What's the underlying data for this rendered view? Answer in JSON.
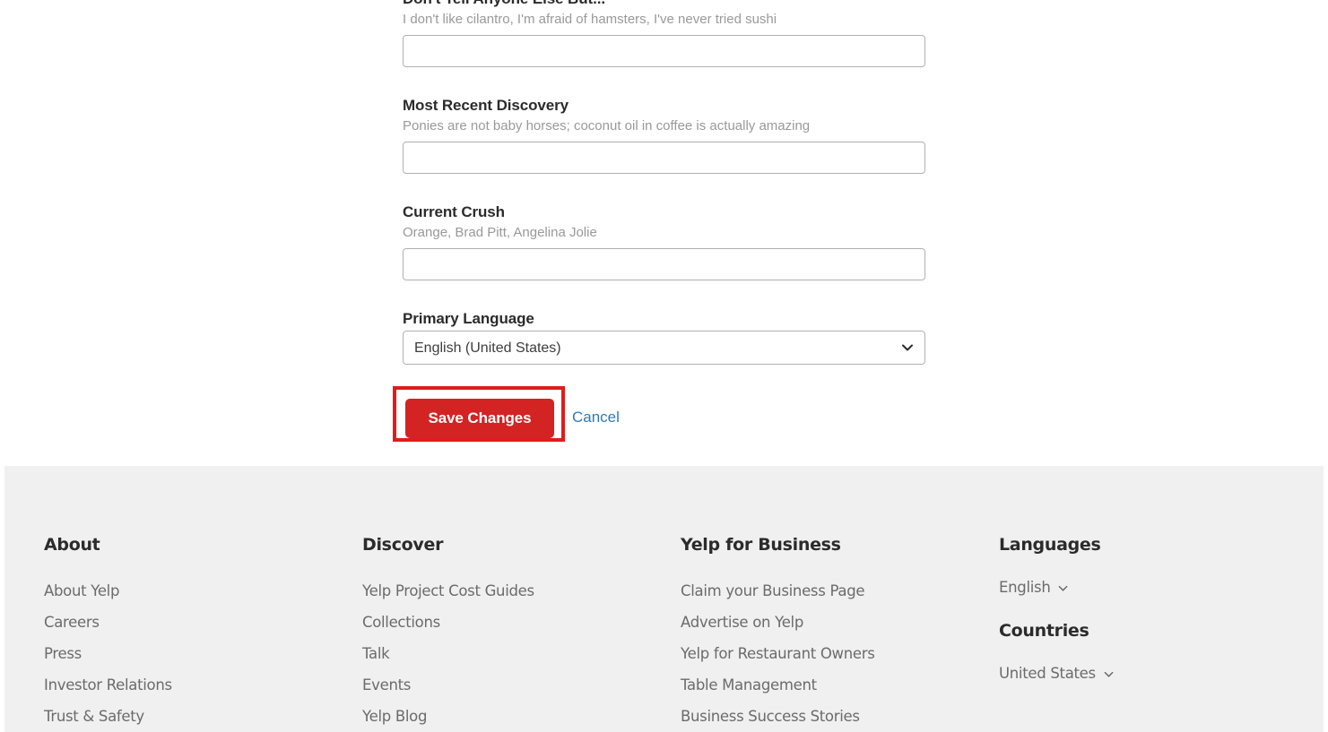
{
  "form": {
    "fields": [
      {
        "label": "Don't Tell Anyone Else But...",
        "hint": "I don't like cilantro, I'm afraid of hamsters, I've never tried sushi",
        "value": "",
        "placeholder": ""
      },
      {
        "label": "Most Recent Discovery",
        "hint": "Ponies are not baby horses; coconut oil in coffee is actually amazing",
        "value": "",
        "placeholder": ""
      },
      {
        "label": "Current Crush",
        "hint": "Orange, Brad Pitt, Angelina Jolie",
        "value": "",
        "placeholder": ""
      }
    ],
    "language_field": {
      "label": "Primary Language",
      "selected": "English (United States)",
      "options": [
        "English (United States)"
      ]
    },
    "save_label": "Save Changes",
    "cancel_label": "Cancel",
    "accent_color": "#d32323",
    "highlight_color": "#e21b1b",
    "link_color": "#2b7bb9"
  },
  "footer": {
    "background_color": "#f0f0f0",
    "columns": [
      {
        "heading": "About",
        "links": [
          "About Yelp",
          "Careers",
          "Press",
          "Investor Relations",
          "Trust & Safety"
        ]
      },
      {
        "heading": "Discover",
        "links": [
          "Yelp Project Cost Guides",
          "Collections",
          "Talk",
          "Events",
          "Yelp Blog"
        ]
      },
      {
        "heading": "Yelp for Business",
        "links": [
          "Claim your Business Page",
          "Advertise on Yelp",
          "Yelp for Restaurant Owners",
          "Table Management",
          "Business Success Stories"
        ]
      }
    ],
    "languages": {
      "heading": "Languages",
      "selected": "English"
    },
    "countries": {
      "heading": "Countries",
      "selected": "United States"
    }
  }
}
